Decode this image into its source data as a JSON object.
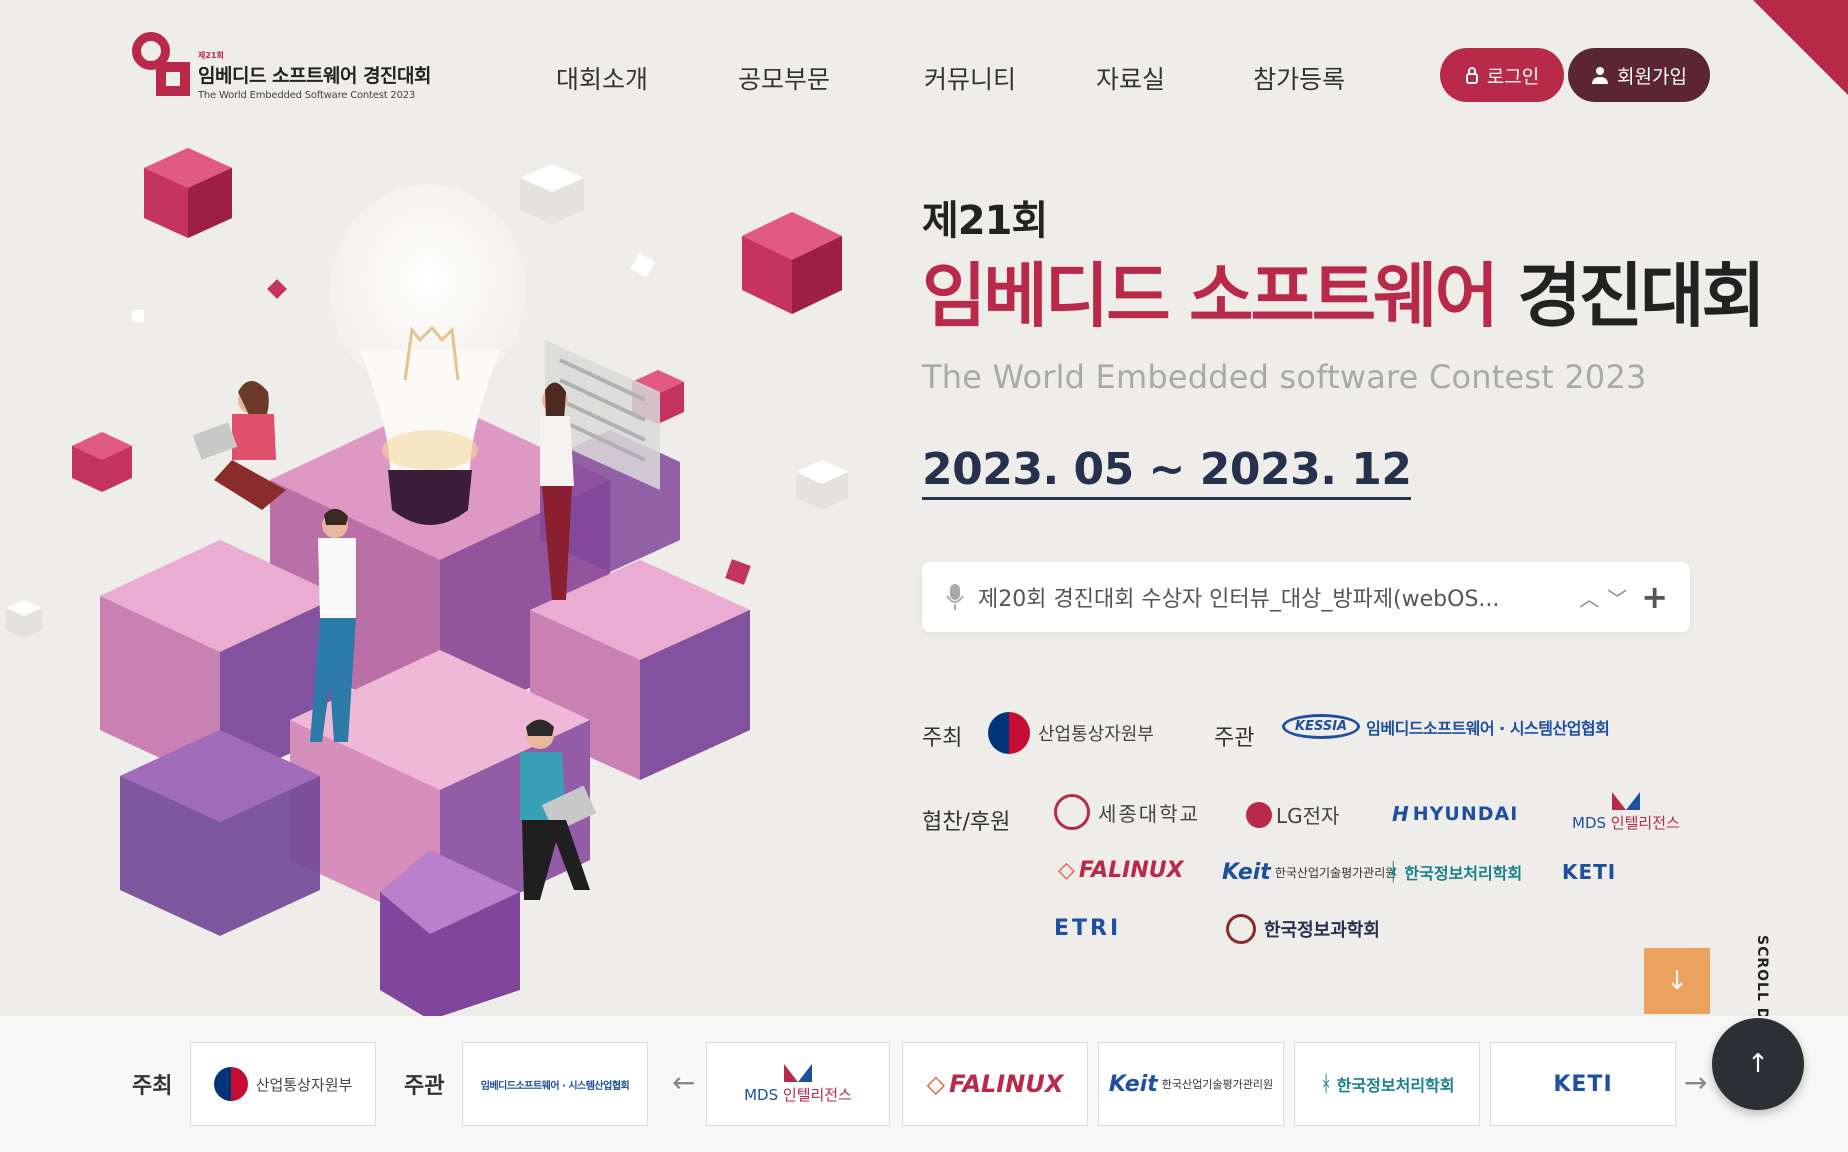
{
  "brand": {
    "edition_small": "제21회",
    "title_red": "임베디드 소프트웨어",
    "title_dark": "경진대회",
    "subtitle": "The World Embedded Software Contest 2023"
  },
  "nav": {
    "items": [
      "대회소개",
      "공모부문",
      "커뮤니티",
      "자료실",
      "참가등록"
    ],
    "login_label": "로그인",
    "signup_label": "회원가입"
  },
  "hero": {
    "edition": "제21회",
    "title_red": "임베디드 소프트웨어",
    "title_dark": "경진대회",
    "subtitle": "The World Embedded software Contest 2023",
    "date": "2023. 05 ~ 2023. 12"
  },
  "news": {
    "text": "제20회 경진대회 수상자 인터뷰_대상_방파제(webOS...",
    "icons": [
      "mic-icon",
      "chevron-up-icon",
      "chevron-down-icon",
      "plus-icon"
    ]
  },
  "orgs": {
    "host_label": "주최",
    "host_name": "산업통상자원부",
    "organizer_label": "주관",
    "organizer_abbr": "KESSIA",
    "organizer_name": "임베디드소프트웨어 · 시스템산업협회",
    "sponsor_label": "협찬/후원",
    "sejong": "세종대학교",
    "lg": "LG전자",
    "hyundai": "HYUNDAI",
    "mds_a": "MDS",
    "mds_b": "인텔리전스",
    "falinux": "FALINUX",
    "keit_abbr": "Keit",
    "keit_name": "한국산업기술평가관리원",
    "kips": "한국정보처리학회",
    "keti_abbr": "KETI",
    "etri": "ETRI",
    "kiise": "한국정보과학회"
  },
  "scroll": {
    "label": "SCROLL DOWN",
    "down_icon": "arrow-down-icon",
    "top_icon": "arrow-up-icon"
  },
  "footer": {
    "host_label": "주최",
    "host_name": "산업통상자원부",
    "organizer_label": "주관",
    "organizer_name": "임베디드소프트웨어 · 시스템산업협회",
    "mds_a": "MDS",
    "mds_b": "인텔리전스",
    "falinux": "FALINUX",
    "keit_abbr": "Keit",
    "keit_name": "한국산업기술평가관리원",
    "kips": "한국정보처리학회",
    "keti_abbr": "KETI"
  },
  "colors": {
    "brand_red": "#b8294a",
    "navy": "#25314d",
    "bg": "#efede9",
    "accent_orange": "#eca25f"
  }
}
